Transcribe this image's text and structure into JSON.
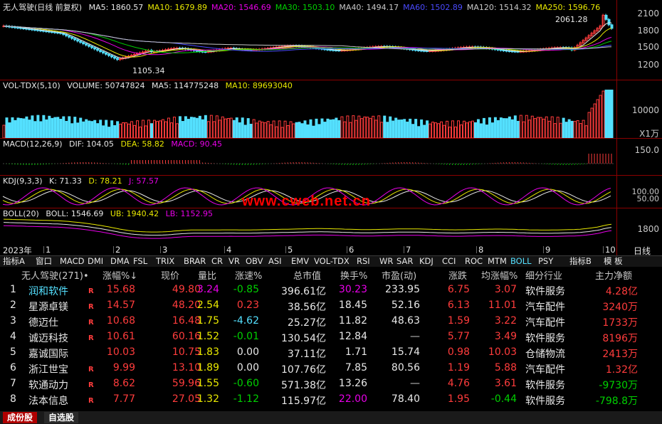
{
  "main_panel": {
    "title": "无人驾驶(日线 前复权)",
    "ma": [
      {
        "label": "MA5: 1860.57",
        "color": "#e8e8e8"
      },
      {
        "label": "MA10: 1679.89",
        "color": "#e8e800"
      },
      {
        "label": "MA20: 1546.69",
        "color": "#e800e8"
      },
      {
        "label": "MA30: 1503.10",
        "color": "#00d000"
      },
      {
        "label": "MA40: 1494.17",
        "color": "#c8c8c8"
      },
      {
        "label": "MA60: 1502.89",
        "color": "#4a4aff"
      },
      {
        "label": "MA120: 1514.32",
        "color": "#c8c8c8"
      },
      {
        "label": "MA250: 1596.76",
        "color": "#e8e800"
      }
    ],
    "high_label": "2061.28",
    "low_label": "1105.34",
    "axis": [
      "2100",
      "1800",
      "1500",
      "1200"
    ]
  },
  "vol_panel": {
    "labels": [
      "VOL-TDX(5,10)",
      "VOLUME: 50747824",
      "MA5: 114775248",
      "MA10: 89693040"
    ],
    "axis": "10000",
    "unit": "X1万"
  },
  "macd_panel": {
    "labels": [
      "MACD(12,26,9)",
      "DIF: 104.05",
      "DEA: 58.82",
      "MACD: 90.45"
    ],
    "axis": "150.0"
  },
  "kdj_panel": {
    "labels": [
      "KDJ(9,3,3)",
      "K: 71.33",
      "D: 78.21",
      "J: 57.57"
    ],
    "axis": [
      "100.00",
      "50.00"
    ]
  },
  "boll_panel": {
    "labels": [
      "BOLL(20)",
      "BOLL: 1546.69",
      "UB: 1940.42",
      "LB: 1152.95"
    ],
    "axis": "1800"
  },
  "watermark": "www.cweb.net.cn",
  "time_axis": {
    "year": "2023年",
    "months": [
      "1",
      "2",
      "3",
      "4",
      "5",
      "6",
      "7",
      "8",
      "9",
      "10"
    ],
    "period": "日线"
  },
  "indicator_tabs": [
    "指标A",
    "窗口",
    "MACD",
    "DMI",
    "DMA",
    "FSL",
    "TRIX",
    "BRAR",
    "CR",
    "VR",
    "OBV",
    "ASI",
    "EMV",
    "VOL-TDX",
    "RSI",
    "WR",
    "SAR",
    "KDJ",
    "CCI",
    "ROC",
    "MTM",
    "BOLL",
    "PSY",
    "指标B",
    "模 板"
  ],
  "active_tab": "BOLL",
  "table": {
    "headers": [
      "无人驾驶(271)•",
      "涨幅%↓",
      "现价",
      "量比",
      "涨速%",
      "总市值",
      "换手%",
      "市盈(动)",
      "涨跌",
      "均涨幅%",
      "细分行业",
      "主力净额"
    ],
    "rows": [
      {
        "idx": "1",
        "name": "润和软件",
        "flag": "R",
        "pct": "15.68",
        "price": "49.80",
        "vr": "3.24",
        "speed": "-0.85",
        "cap": "396.61亿",
        "turn": "30.23",
        "pe": "233.95",
        "chg": "6.75",
        "avg": "3.07",
        "ind": "软件服务",
        "net": "4.28亿",
        "name_color": "#54e0ff",
        "vr_color": "#e800e8",
        "speed_color": "#00d000",
        "turn_color": "#e800e8",
        "net_color": "#ff3c3c"
      },
      {
        "idx": "2",
        "name": "星源卓镁",
        "flag": "R",
        "pct": "14.57",
        "price": "48.20",
        "vr": "2.54",
        "speed": "0.23",
        "cap": "38.56亿",
        "turn": "18.45",
        "pe": "52.16",
        "chg": "6.13",
        "avg": "11.01",
        "ind": "汽车配件",
        "net": "3240万",
        "name_color": "#e8e8e8",
        "vr_color": "#e8e800",
        "speed_color": "#ff3c3c",
        "turn_color": "#e8e8e8",
        "net_color": "#ff3c3c"
      },
      {
        "idx": "3",
        "name": "德迈仕",
        "flag": "R",
        "pct": "10.68",
        "price": "16.48",
        "vr": "1.75",
        "speed": "-4.62",
        "cap": "25.27亿",
        "turn": "11.82",
        "pe": "48.63",
        "chg": "1.59",
        "avg": "3.22",
        "ind": "汽车配件",
        "net": "1733万",
        "name_color": "#e8e8e8",
        "vr_color": "#e8e800",
        "speed_color": "#54e0ff",
        "turn_color": "#e8e8e8",
        "net_color": "#ff3c3c"
      },
      {
        "idx": "4",
        "name": "诚迈科技",
        "flag": "R",
        "pct": "10.61",
        "price": "60.16",
        "vr": "1.52",
        "speed": "-0.01",
        "cap": "130.54亿",
        "turn": "12.84",
        "pe": "—",
        "chg": "5.77",
        "avg": "3.49",
        "ind": "软件服务",
        "net": "8196万",
        "name_color": "#e8e8e8",
        "vr_color": "#e8e800",
        "speed_color": "#00d000",
        "turn_color": "#e8e8e8",
        "net_color": "#ff3c3c"
      },
      {
        "idx": "5",
        "name": "嘉诚国际",
        "flag": "",
        "pct": "10.03",
        "price": "10.75",
        "vr": "1.83",
        "speed": "0.00",
        "cap": "37.11亿",
        "turn": "1.71",
        "pe": "15.74",
        "chg": "0.98",
        "avg": "10.03",
        "ind": "仓储物流",
        "net": "2413万",
        "name_color": "#e8e8e8",
        "vr_color": "#e8e800",
        "speed_color": "#e8e8e8",
        "turn_color": "#e8e8e8",
        "net_color": "#ff3c3c"
      },
      {
        "idx": "6",
        "name": "浙江世宝",
        "flag": "R",
        "pct": "9.99",
        "price": "13.10",
        "vr": "1.89",
        "speed": "0.00",
        "cap": "107.76亿",
        "turn": "7.85",
        "pe": "80.56",
        "chg": "1.19",
        "avg": "5.88",
        "ind": "汽车配件",
        "net": "1.32亿",
        "name_color": "#e8e8e8",
        "vr_color": "#e8e800",
        "speed_color": "#e8e8e8",
        "turn_color": "#e8e8e8",
        "net_color": "#ff3c3c"
      },
      {
        "idx": "7",
        "name": "软通动力",
        "flag": "R",
        "pct": "8.62",
        "price": "59.96",
        "vr": "1.55",
        "speed": "-0.60",
        "cap": "571.38亿",
        "turn": "13.26",
        "pe": "—",
        "chg": "4.76",
        "avg": "3.61",
        "ind": "软件服务",
        "net": "-9730万",
        "name_color": "#e8e8e8",
        "vr_color": "#e8e800",
        "speed_color": "#00d000",
        "turn_color": "#e8e8e8",
        "net_color": "#00d000"
      },
      {
        "idx": "8",
        "name": "法本信息",
        "flag": "R",
        "pct": "7.77",
        "price": "27.05",
        "vr": "1.32",
        "speed": "-1.12",
        "cap": "115.97亿",
        "turn": "22.00",
        "pe": "78.40",
        "chg": "1.95",
        "avg": "-0.44",
        "ind": "软件服务",
        "net": "-798.8万",
        "name_color": "#e8e8e8",
        "vr_color": "#e8e800",
        "speed_color": "#00d000",
        "turn_color": "#e800e8",
        "net_color": "#00d000"
      }
    ]
  },
  "bottom_tabs": [
    "成份股",
    "自选股"
  ]
}
